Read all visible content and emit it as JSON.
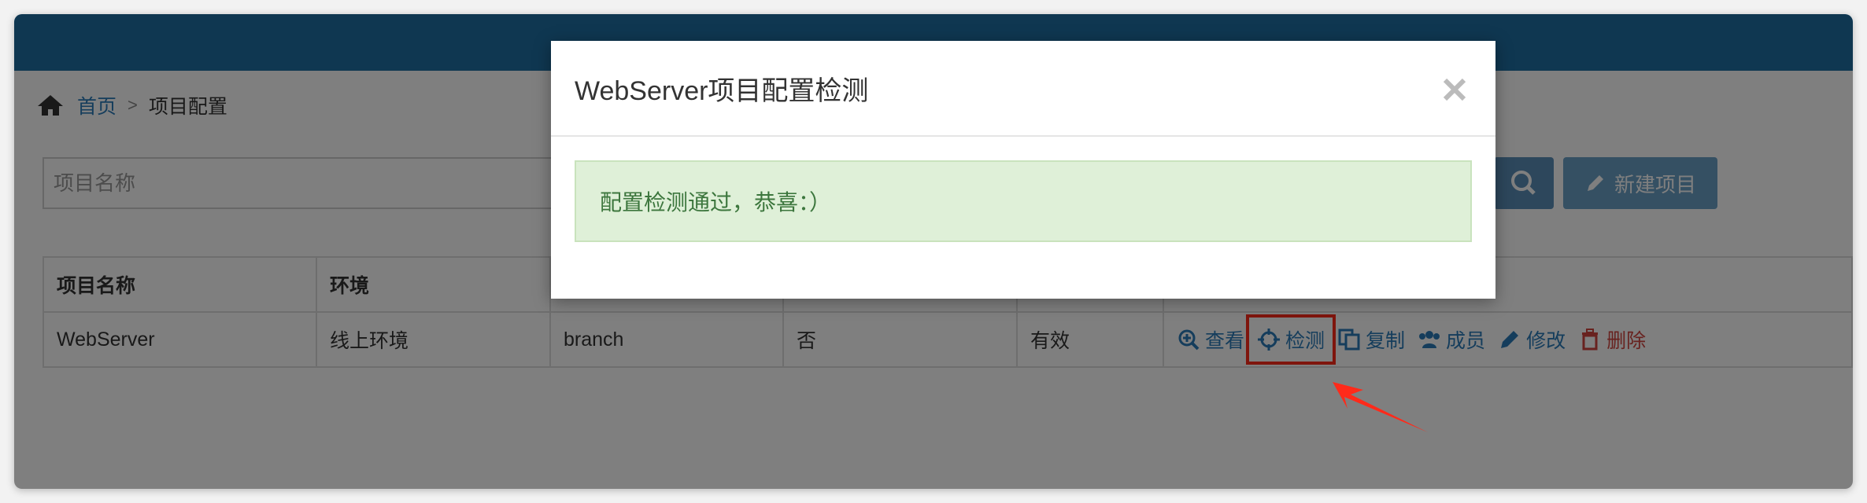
{
  "breadcrumb": {
    "home": "首页",
    "separator": ">",
    "current": "项目配置"
  },
  "toolbar": {
    "search_placeholder": "项目名称",
    "new_button": "新建项目"
  },
  "table": {
    "headers": [
      "项目名称",
      "环境",
      "",
      "",
      "",
      ""
    ],
    "rows": [
      {
        "name": "WebServer",
        "env": "线上环境",
        "branch": "branch",
        "flag": "否",
        "status": "有效"
      }
    ]
  },
  "actions": {
    "view": "查看",
    "check": "检测",
    "copy": "复制",
    "members": "成员",
    "edit": "修改",
    "delete": "删除"
  },
  "modal": {
    "title": "WebServer项目配置检测",
    "message": "配置检测通过，恭喜：）",
    "close_glyph": "×"
  },
  "colors": {
    "topbar": "#1f6fa3",
    "link": "#2a7bb9",
    "danger": "#d0443e",
    "alert_bg": "#dff0d8",
    "alert_text": "#3c763d",
    "highlight": "#ff2a1a"
  }
}
